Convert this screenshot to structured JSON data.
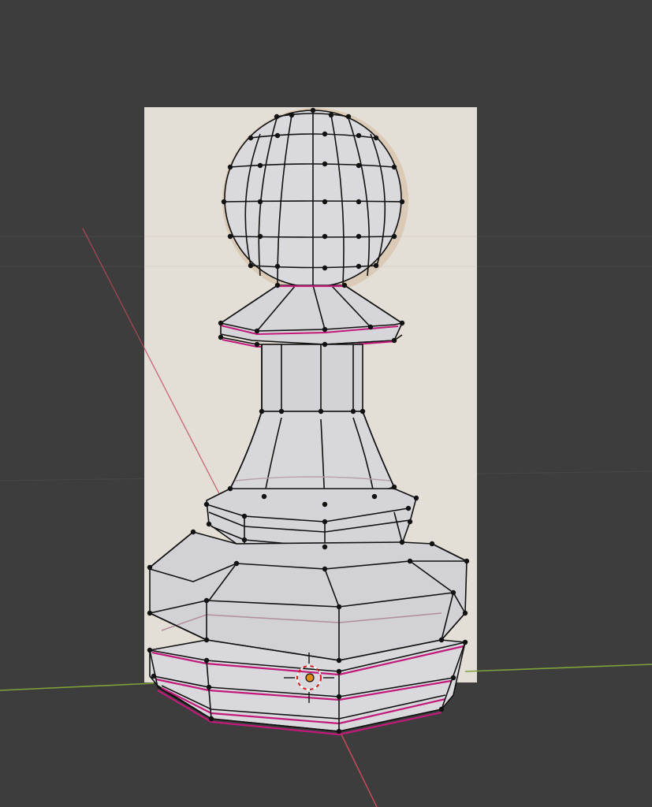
{
  "viewport": {
    "background": "#3d3d3d",
    "grid_color": "#4a4a4a",
    "axis_x_color": "#bf4a5a",
    "axis_y_color": "#7fa03a"
  },
  "reference_image": {
    "fill": "#e4dfd6"
  },
  "mesh": {
    "object": "pawn",
    "face_color": "#d9d9dd",
    "edge_color": "#111111",
    "vertex_color": "#111111",
    "seam_color": "#c11a7a"
  },
  "origin": {
    "icon": "object-origin-icon",
    "fill": "#e08a1a",
    "ring_color": "#d02020"
  },
  "cursor_3d": {
    "icon": "3d-cursor-icon"
  }
}
